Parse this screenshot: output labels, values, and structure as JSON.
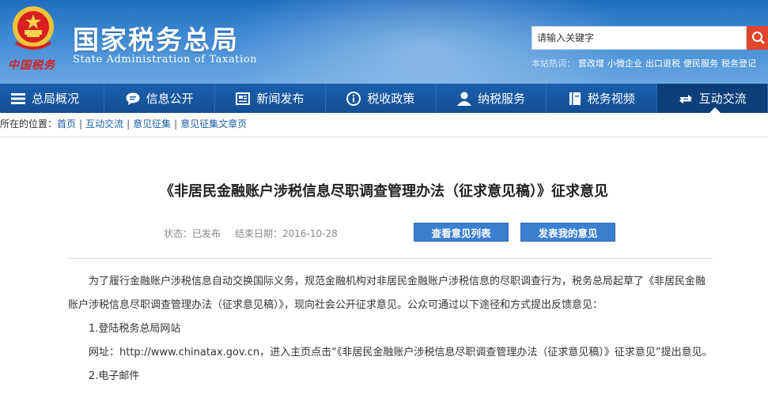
{
  "header": {
    "site_name_cn": "国家税务总局",
    "site_name_en": "State Administration of Taxation",
    "slogan": "中国税务",
    "search_placeholder": "请输入关键字",
    "hot_label": "本站热词：",
    "hot_keywords": [
      "营改增",
      "小微企业",
      "出口退税",
      "便民服务",
      "税务登记"
    ]
  },
  "nav": {
    "items": [
      {
        "label": "总局概况",
        "icon": "menu-icon"
      },
      {
        "label": "信息公开",
        "icon": "chat-icon"
      },
      {
        "label": "新闻发布",
        "icon": "news-icon"
      },
      {
        "label": "税收政策",
        "icon": "info-icon"
      },
      {
        "label": "纳税服务",
        "icon": "user-icon"
      },
      {
        "label": "税务视频",
        "icon": "book-icon"
      },
      {
        "label": "互动交流",
        "icon": "exchange-icon",
        "active": true
      }
    ]
  },
  "breadcrumb": {
    "prefix": "您所在的位置：",
    "items": [
      "首页",
      "互动交流",
      "意见征集",
      "意见征集文章页"
    ]
  },
  "article": {
    "title": "《非居民金融账户涉税信息尽职调查管理办法（征求意见稿）》征求意见",
    "status": "状态：已发布",
    "end_date": "结束日期：2016-10-28",
    "view_list_button": "查看意见列表",
    "feedback_button": "发表我的意见",
    "para1": "为了履行金融账户涉税信息自动交换国际义务，规范金融机构对非居民金融账户涉税信息的尽职调查行为，税务总局起草了《非居民金融账户涉税信息尽职调查管理办法（征求意见稿）》，现向社会公开征求意见。公众可通过以下途径和方式提出反馈意见：",
    "item1": "1.登陆税务总局网站",
    "para2": "网址：http://www.chinatax.gov.cn，进入主页点击“《非居民金融账户涉税信息尽职调查管理办法（征求意见稿）》征求意见”提出意见。",
    "item2": "2.电子邮件"
  },
  "colors": {
    "header_blue": "#2f7fcf",
    "nav_blue": "#134f94",
    "search_button": "#e1452c",
    "action_button": "#3b7fd0",
    "link_blue": "#1a5ea8"
  }
}
